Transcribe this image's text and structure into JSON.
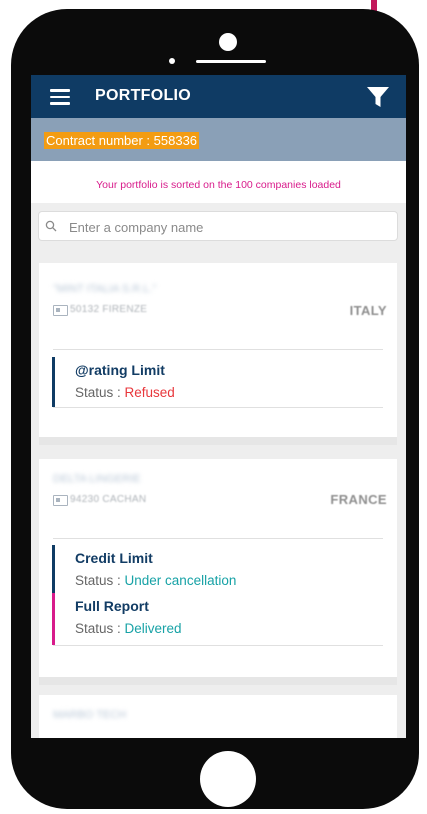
{
  "colors": {
    "topbar": "#0f3b64",
    "contract_bar": "#8aa0b7",
    "contract_highlight": "#f39c12",
    "notice": "#d81b8b",
    "arrow": "#c2185b",
    "status_refused": "#e8373c",
    "status_positive": "#17a2a6"
  },
  "header": {
    "title": "PORTFOLIO",
    "menu_icon": "hamburger-menu-icon",
    "filter_icon": "filter-funnel-icon"
  },
  "contract": {
    "label": "Contract number : ",
    "number": "558336"
  },
  "notice": "Your portfolio is sorted on the 100 companies loaded",
  "search": {
    "placeholder": "Enter a company name",
    "icon": "search-icon"
  },
  "companies": [
    {
      "name": "\"MINT ITALIA S.R.L.\"",
      "postal": "50132 FIRENZE",
      "country": "ITALY",
      "products": [
        {
          "name": "@rating Limit",
          "status_label": "Status : ",
          "status_value": "Refused",
          "status_color": "#e8373c",
          "accent": "#0f3b64"
        }
      ]
    },
    {
      "name": "DELTA LINGERIE",
      "postal": "94230 CACHAN",
      "country": "FRANCE",
      "products": [
        {
          "name": "Credit Limit",
          "status_label": "Status : ",
          "status_value": "Under cancellation",
          "status_color": "#17a2a6",
          "accent": "#0f3b64"
        },
        {
          "name": "Full Report",
          "status_label": "Status : ",
          "status_value": "Delivered",
          "status_color": "#17a2a6",
          "accent": "#d81b8b"
        }
      ]
    },
    {
      "name": "MARBO TECH"
    }
  ]
}
